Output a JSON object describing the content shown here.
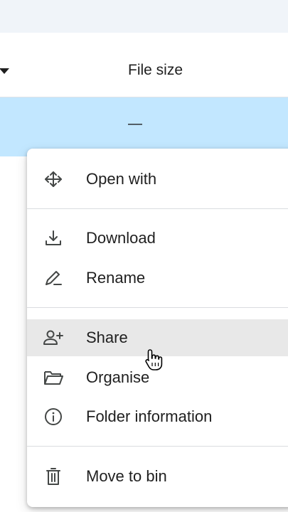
{
  "table": {
    "column_header": "File size",
    "selected_row_size": "—"
  },
  "context_menu": {
    "items": [
      {
        "label": "Open with",
        "icon": "move-arrows-icon"
      },
      {
        "label": "Download",
        "icon": "download-icon"
      },
      {
        "label": "Rename",
        "icon": "rename-pen-icon"
      },
      {
        "label": "Share",
        "icon": "person-add-icon"
      },
      {
        "label": "Organise",
        "icon": "folder-open-icon"
      },
      {
        "label": "Folder information",
        "icon": "info-icon"
      },
      {
        "label": "Move to bin",
        "icon": "trash-icon"
      }
    ],
    "hovered_item": "Share"
  },
  "colors": {
    "selected_row": "#c2e7ff",
    "hover": "#e8e8e8",
    "top_strip": "#f0f4f9"
  }
}
